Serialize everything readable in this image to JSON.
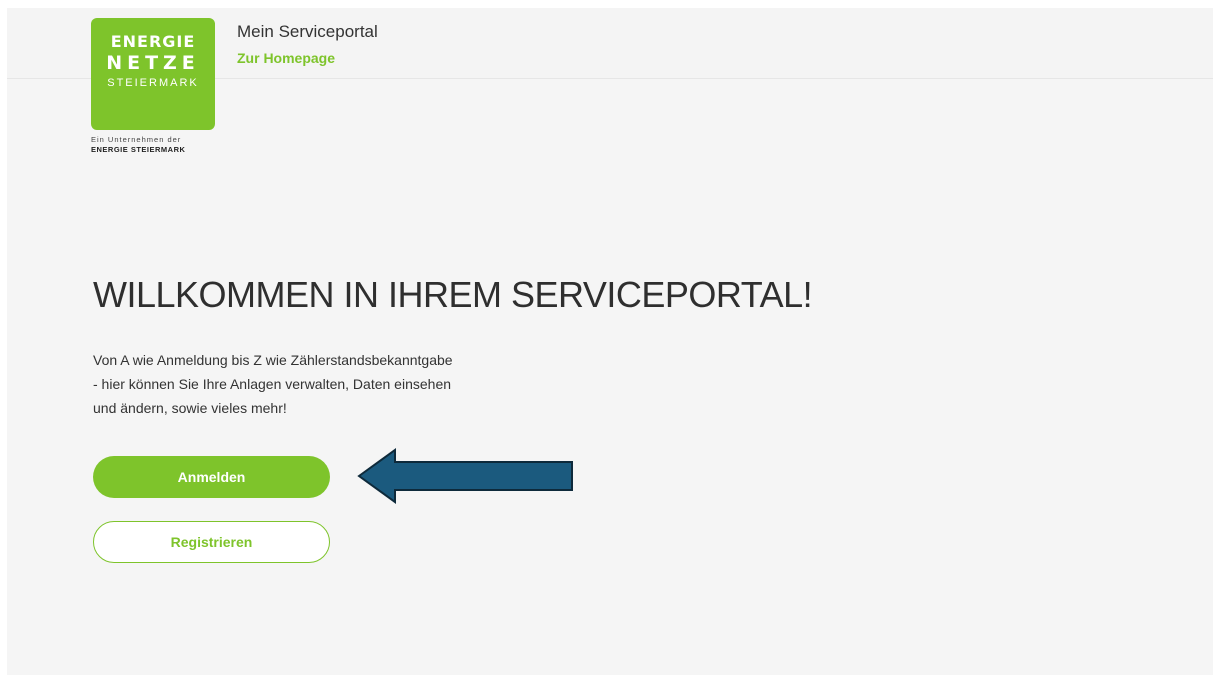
{
  "header": {
    "logo": {
      "line1": "ENERGIE",
      "line2": "NETZE",
      "line3": "STEIERMARK",
      "sub1": "Ein Unternehmen der",
      "sub2": "ENERGIE STEIERMARK"
    },
    "portal_title": "Mein Serviceportal",
    "homepage_link": "Zur Homepage"
  },
  "main": {
    "title": "WILLKOMMEN IN IHREM SERVICEPORTAL!",
    "intro_lines": [
      "Von A wie Anmeldung bis Z wie Zählerstandsbekanntgabe",
      "- hier können Sie Ihre Anlagen verwalten, Daten einsehen",
      "und ändern, sowie vieles mehr!"
    ],
    "login_label": "Anmelden",
    "register_label": "Registrieren"
  },
  "annotation": {
    "arrow_icon": "left-arrow-icon",
    "arrow_color": "#1b5a7e"
  },
  "colors": {
    "brand_green": "#7ec42b",
    "background": "#f5f5f5"
  }
}
